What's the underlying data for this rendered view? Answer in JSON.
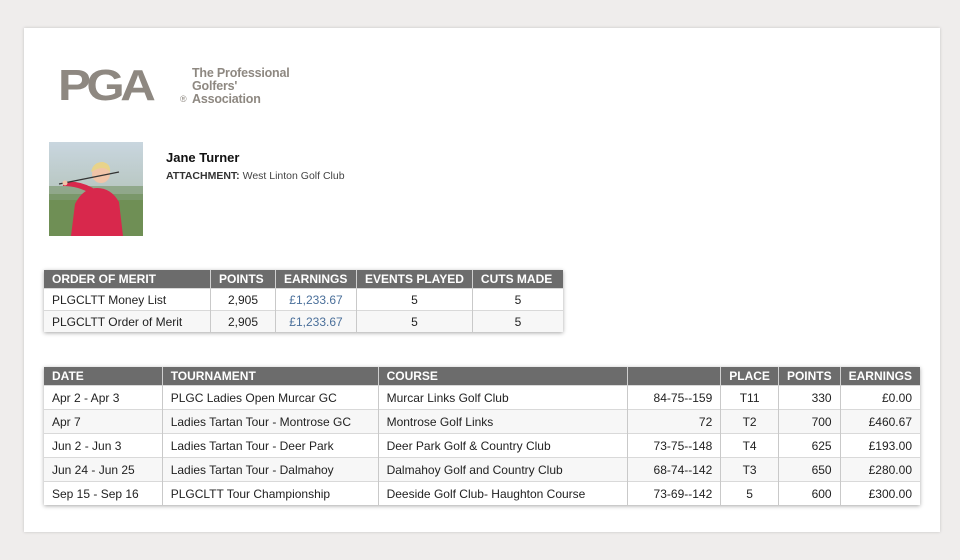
{
  "logo": {
    "mark": "PGA",
    "registered": "®",
    "lines": [
      "The Professional",
      "Golfers'",
      "Association"
    ]
  },
  "profile": {
    "name": "Jane Turner",
    "attachment_label": "ATTACHMENT:",
    "attachment_value": "West Linton Golf Club"
  },
  "order_of_merit": {
    "headers": [
      "ORDER OF MERIT",
      "POINTS",
      "EARNINGS",
      "EVENTS PLAYED",
      "CUTS MADE"
    ],
    "rows": [
      {
        "name": "PLGCLTT Money List",
        "points": "2,905",
        "earnings": "£1,233.67",
        "events": "5",
        "cuts": "5"
      },
      {
        "name": "PLGCLTT Order of Merit",
        "points": "2,905",
        "earnings": "£1,233.67",
        "events": "5",
        "cuts": "5"
      }
    ]
  },
  "results": {
    "headers": [
      "DATE",
      "TOURNAMENT",
      "COURSE",
      "",
      "PLACE",
      "POINTS",
      "EARNINGS"
    ],
    "rows": [
      {
        "date": "Apr 2 - Apr 3",
        "tournament": "PLGC Ladies Open Murcar GC",
        "course": "Murcar Links Golf Club",
        "score": "84-75--159",
        "place": "T11",
        "points": "330",
        "earnings": "£0.00"
      },
      {
        "date": "Apr 7",
        "tournament": "Ladies Tartan Tour - Montrose GC",
        "course": "Montrose Golf Links",
        "score": "72",
        "place": "T2",
        "points": "700",
        "earnings": "£460.67"
      },
      {
        "date": "Jun 2 - Jun 3",
        "tournament": "Ladies Tartan Tour - Deer Park",
        "course": "Deer Park Golf & Country Club",
        "score": "73-75--148",
        "place": "T4",
        "points": "625",
        "earnings": "£193.00"
      },
      {
        "date": "Jun 24 - Jun 25",
        "tournament": "Ladies Tartan Tour - Dalmahoy",
        "course": "Dalmahoy Golf and Country Club",
        "score": "68-74--142",
        "place": "T3",
        "points": "650",
        "earnings": "£280.00"
      },
      {
        "date": "Sep 15 - Sep 16",
        "tournament": "PLGCLTT Tour Championship",
        "course": "Deeside Golf Club- Haughton Course",
        "score": "73-69--142",
        "place": "5",
        "points": "600",
        "earnings": "£300.00"
      }
    ]
  }
}
